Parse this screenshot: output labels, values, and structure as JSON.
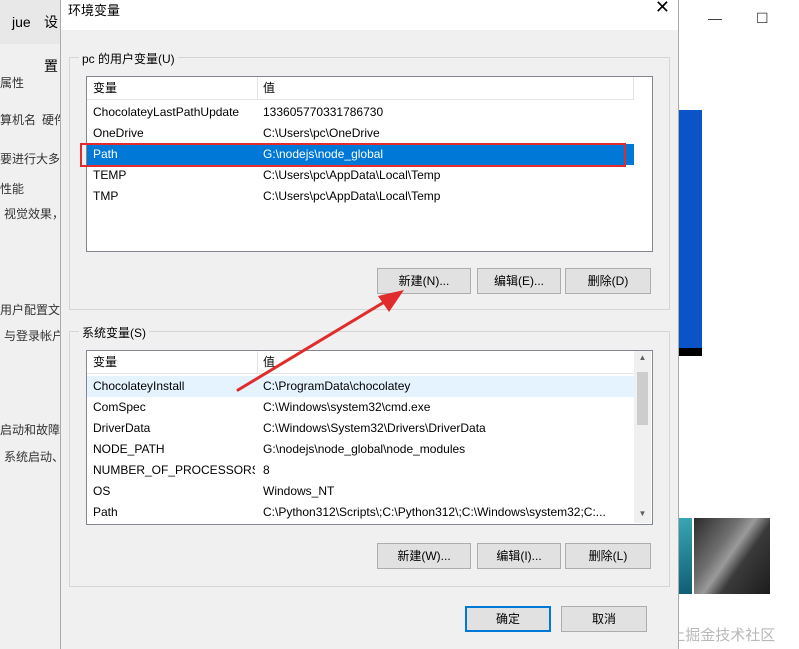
{
  "background": {
    "tab1_text": "jue",
    "tab2_text": "设置",
    "left_texts": [
      "属性",
      "算机名",
      "硬件",
      "要进行大多数",
      "性能",
      "视觉效果，",
      "用户配置文",
      "与登录帐户",
      "启动和故障",
      "系统启动、"
    ],
    "watermark": "@稀土掘金技术社区",
    "colors": {
      "blue_panel": "#0a54c8"
    }
  },
  "dialog": {
    "title": "环境变量",
    "user_vars": {
      "group_label": "pc 的用户变量(U)",
      "columns": [
        "变量",
        "值"
      ],
      "rows": [
        {
          "name": "ChocolateyLastPathUpdate",
          "value": "133605770331786730",
          "selected": false
        },
        {
          "name": "OneDrive",
          "value": "C:\\Users\\pc\\OneDrive",
          "selected": false
        },
        {
          "name": "Path",
          "value": "G:\\nodejs\\node_global",
          "selected": true
        },
        {
          "name": "TEMP",
          "value": "C:\\Users\\pc\\AppData\\Local\\Temp",
          "selected": false
        },
        {
          "name": "TMP",
          "value": "C:\\Users\\pc\\AppData\\Local\\Temp",
          "selected": false
        }
      ],
      "buttons": {
        "new": "新建(N)...",
        "edit": "编辑(E)...",
        "delete": "删除(D)"
      }
    },
    "system_vars": {
      "group_label": "系统变量(S)",
      "columns": [
        "变量",
        "值"
      ],
      "rows": [
        {
          "name": "ChocolateyInstall",
          "value": "C:\\ProgramData\\chocolatey"
        },
        {
          "name": "ComSpec",
          "value": "C:\\Windows\\system32\\cmd.exe"
        },
        {
          "name": "DriverData",
          "value": "C:\\Windows\\System32\\Drivers\\DriverData"
        },
        {
          "name": "NODE_PATH",
          "value": "G:\\nodejs\\node_global\\node_modules"
        },
        {
          "name": "NUMBER_OF_PROCESSORS",
          "value": "8"
        },
        {
          "name": "OS",
          "value": "Windows_NT"
        },
        {
          "name": "Path",
          "value": "C:\\Python312\\Scripts\\;C:\\Python312\\;C:\\Windows\\system32;C:..."
        }
      ],
      "buttons": {
        "new": "新建(W)...",
        "edit": "编辑(I)...",
        "delete": "删除(L)"
      }
    },
    "ok_label": "确定",
    "cancel_label": "取消",
    "close_glyph": "✕"
  },
  "colors": {
    "selection": "#0078d7",
    "annotation": "#e02c2c"
  }
}
